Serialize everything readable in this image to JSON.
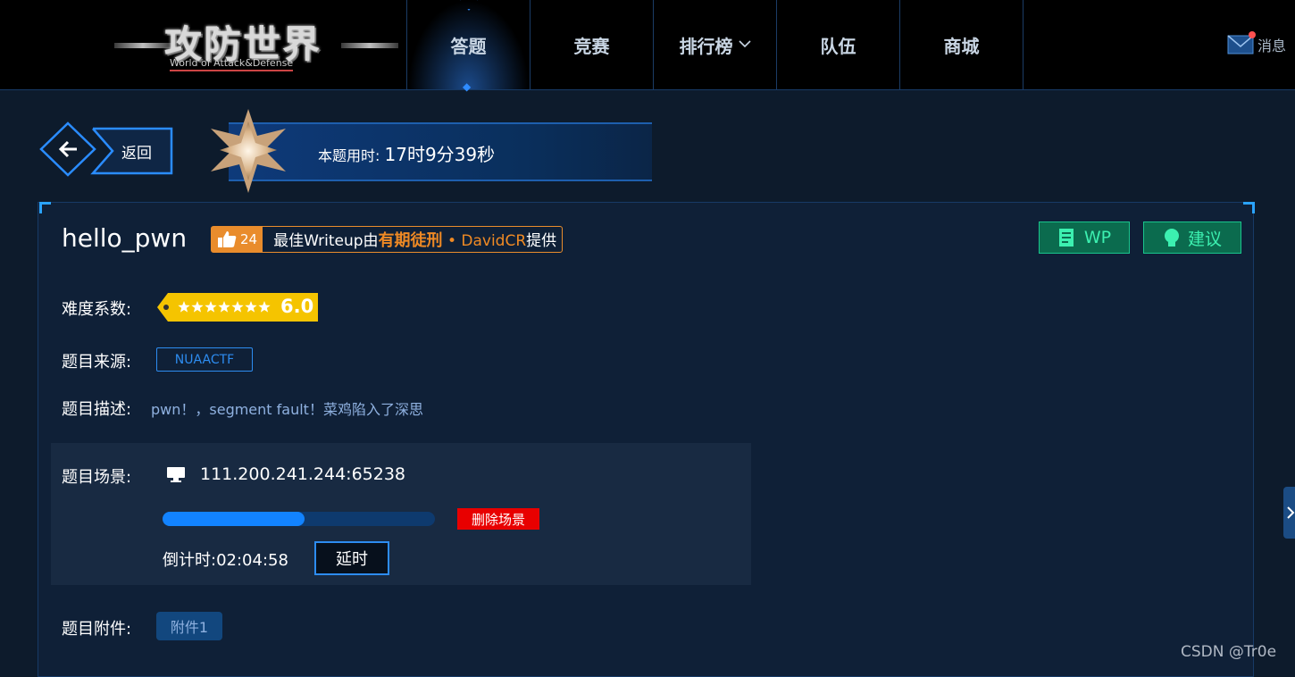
{
  "logo": {
    "title": "攻防世界",
    "subtitle": "World of Attack&Defense"
  },
  "nav": {
    "items": [
      {
        "label": "答题",
        "active": true
      },
      {
        "label": "竞赛",
        "active": false
      },
      {
        "label": "排行榜",
        "active": false,
        "dropdown": true
      },
      {
        "label": "队伍",
        "active": false
      },
      {
        "label": "商城",
        "active": false
      }
    ],
    "messages_label": "消息"
  },
  "back": {
    "label": "返回"
  },
  "timer": {
    "label": "本题用时:",
    "value": "17时9分39秒"
  },
  "task": {
    "title": "hello_pwn",
    "likes": "24",
    "writeup_prefix": "最佳Writeup由",
    "writeup_team": "有期徒刑",
    "writeup_sep": " • ",
    "writeup_author": "DavidCR",
    "writeup_suffix": "提供",
    "wp_label": "WP",
    "suggest_label": "建议"
  },
  "difficulty": {
    "label": "难度系数:",
    "stars": 7,
    "value": "6.0"
  },
  "source": {
    "label": "题目来源:",
    "tag": "NUAACTF"
  },
  "description": {
    "label": "题目描述:",
    "text": "pwn！，segment fault！菜鸡陷入了深思"
  },
  "scene": {
    "label": "题目场景:",
    "address": "111.200.241.244:65238",
    "progress": 0.52,
    "delete_label": "删除场景",
    "countdown_label": "倒计时:",
    "countdown_value": "02:04:58",
    "extend_label": "延时"
  },
  "attachment": {
    "label": "题目附件:",
    "button": "附件1"
  },
  "watermark": "CSDN @Tr0e",
  "colors": {
    "accent": "#2d8cf0",
    "danger": "#e80000",
    "writeup": "#f08a24",
    "wp": "#3cf0b0"
  }
}
